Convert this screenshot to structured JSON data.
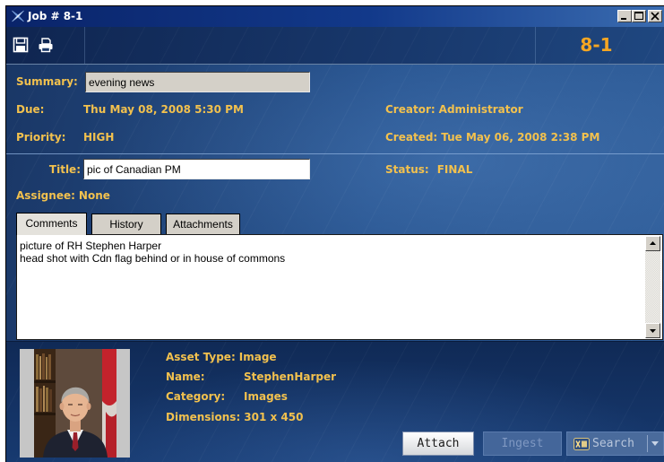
{
  "window": {
    "title": "Job # 8-1"
  },
  "toolbar": {
    "job_number": "8-1"
  },
  "details": {
    "summary": {
      "label": "Summary:",
      "value": "evening news"
    },
    "due": {
      "label": "Due:",
      "value": "Thu May 08, 2008 5:30 PM"
    },
    "priority": {
      "label": "Priority:",
      "value": "HIGH"
    },
    "creator": {
      "label": "Creator:",
      "value": "Administrator"
    },
    "created": {
      "label": "Created:",
      "value": "Tue May 06, 2008 2:38 PM"
    },
    "title": {
      "label": "Title:",
      "value": "pic of Canadian PM"
    },
    "status": {
      "label": "Status:",
      "value": "FINAL"
    },
    "assignee": {
      "label": "Assignee:",
      "value": "None"
    }
  },
  "tabs": [
    {
      "label": "Comments",
      "selected": true
    },
    {
      "label": "History",
      "selected": false
    },
    {
      "label": "Attachments",
      "selected": false
    }
  ],
  "comments": {
    "lines": [
      "picture of RH Stephen Harper",
      "head shot with Cdn flag behind or in house of commons"
    ]
  },
  "asset": {
    "type": {
      "label": "Asset Type:",
      "value": "Image"
    },
    "name": {
      "label": "Name:",
      "value": "StephenHarper"
    },
    "category": {
      "label": "Category:",
      "value": "Images"
    },
    "dimensions": {
      "label": "Dimensions:",
      "value": "301 x 450"
    }
  },
  "actions": {
    "attach": {
      "label": "Attach",
      "enabled": true
    },
    "ingest": {
      "label": "Ingest",
      "enabled": false
    },
    "search": {
      "label": "Search",
      "enabled": false
    }
  },
  "icons": {
    "app": "app-logo-icon",
    "save": "save-icon",
    "print": "print-icon",
    "minimize": "minimize-icon",
    "maximize": "maximize-icon",
    "close": "close-icon",
    "scroll_up": "scroll-up-arrow-icon",
    "scroll_down": "scroll-down-arrow-icon",
    "search": "xms-logo-icon",
    "dropdown": "chevron-down-icon",
    "asset_thumbnail": "portrait-photo"
  },
  "colors": {
    "label": "#f2c14e",
    "job_number": "#f5a623",
    "title_bar": "#0a246a",
    "panel": "#24508c",
    "bottom_panel": "#132f5e",
    "control_face": "#d4d0c8"
  }
}
